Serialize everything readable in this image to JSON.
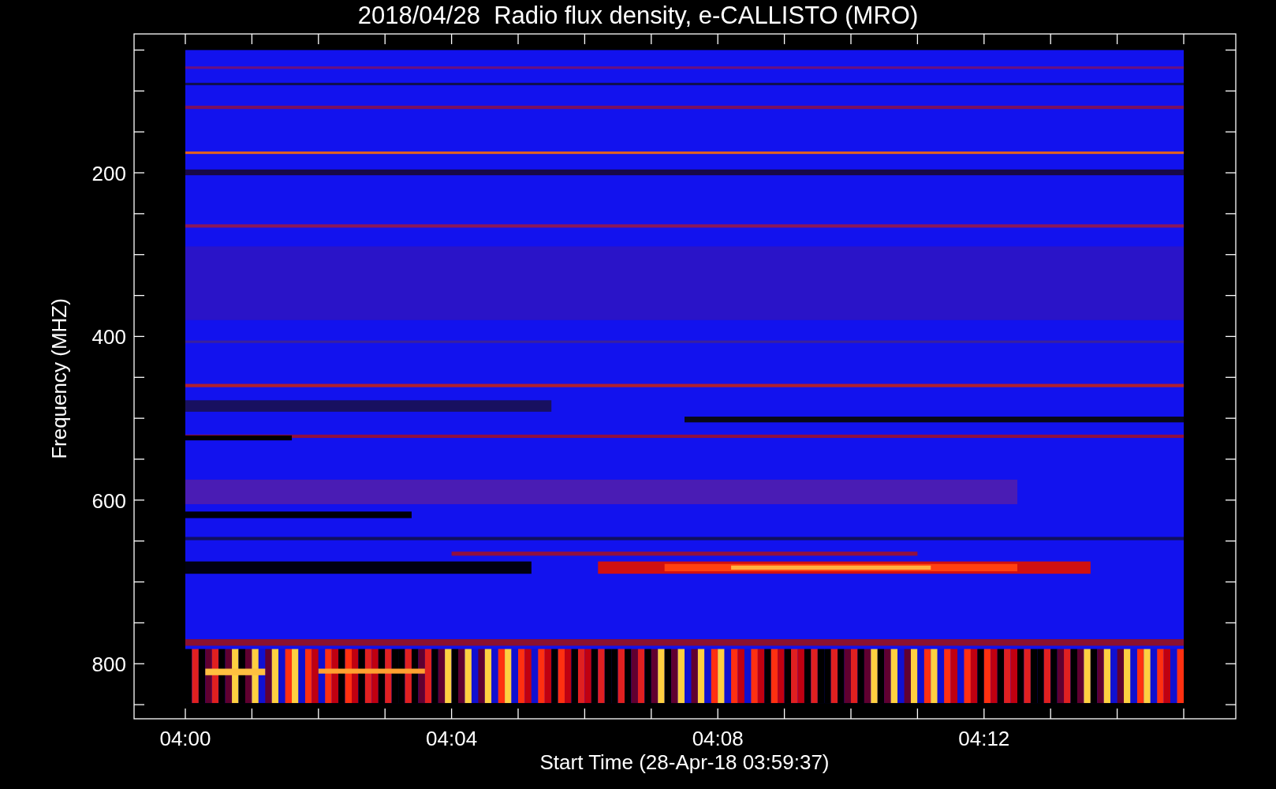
{
  "title": "2018/04/28  Radio flux density, e-CALLISTO (MRO)",
  "y_axis": {
    "label": "Frequency (MHZ)",
    "tick_labels": [
      "200",
      "400",
      "600",
      "800"
    ]
  },
  "x_axis": {
    "label": "Start Time (28-Apr-18 03:59:37)",
    "tick_labels": [
      "04:00",
      "04:04",
      "04:08",
      "04:12"
    ]
  }
}
